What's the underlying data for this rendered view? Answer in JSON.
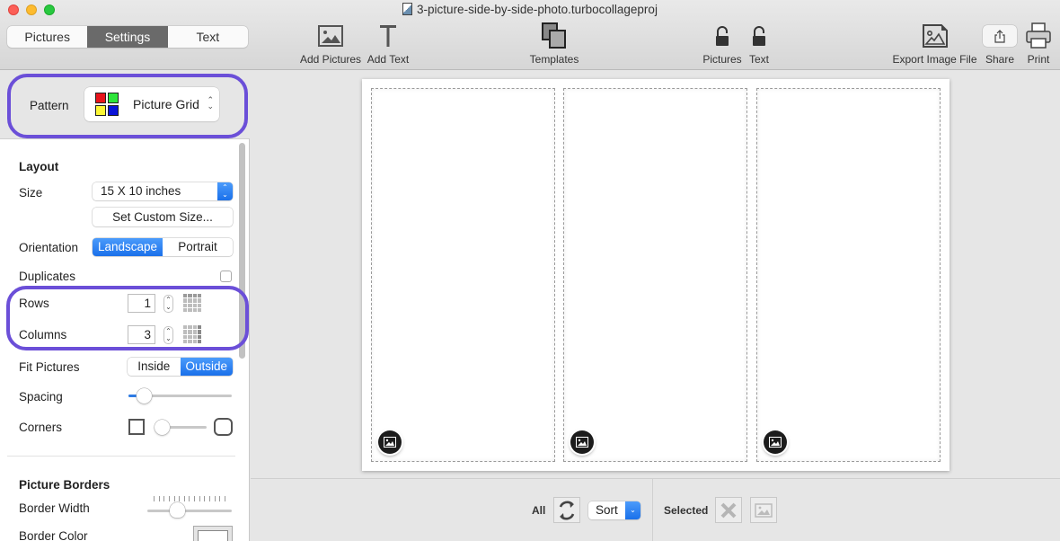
{
  "window": {
    "title": "3-picture-side-by-side-photo.turbocollageproj"
  },
  "tabs": [
    {
      "label": "Pictures",
      "active": false
    },
    {
      "label": "Settings",
      "active": true
    },
    {
      "label": "Text",
      "active": false
    }
  ],
  "toolbar": {
    "add_pictures": "Add Pictures",
    "add_text": "Add Text",
    "templates": "Templates",
    "lock_pictures": "Pictures",
    "lock_text": "Text",
    "export": "Export Image File",
    "share": "Share",
    "print": "Print"
  },
  "pattern": {
    "label": "Pattern",
    "value": "Picture Grid",
    "swatch_colors": [
      "#e8141b",
      "#2ee53a",
      "#fbf635",
      "#0a13d8"
    ]
  },
  "layout": {
    "section_title": "Layout",
    "size_label": "Size",
    "size_value": "15 X 10 inches",
    "custom_size_button": "Set Custom Size...",
    "orientation_label": "Orientation",
    "orientation_options": [
      "Landscape",
      "Portrait"
    ],
    "orientation_selected": "Landscape",
    "duplicates_label": "Duplicates",
    "duplicates_checked": false,
    "rows_label": "Rows",
    "rows_value": "1",
    "columns_label": "Columns",
    "columns_value": "3",
    "fit_label": "Fit Pictures",
    "fit_options": [
      "Inside",
      "Outside"
    ],
    "fit_selected": "Outside",
    "spacing_label": "Spacing",
    "spacing_level": 0.15,
    "corners_label": "Corners",
    "corners_level": 0.0
  },
  "picture_borders": {
    "section_title": "Picture Borders",
    "border_width_label": "Border Width",
    "border_width_level": 0.35,
    "border_color_label": "Border Color",
    "border_color": "#ffffff"
  },
  "canvas": {
    "cells": [
      {
        "name": "picture-cell-1"
      },
      {
        "name": "picture-cell-2"
      },
      {
        "name": "picture-cell-3"
      }
    ]
  },
  "bottom_bar": {
    "all_label": "All",
    "sort_value": "Sort",
    "selected_label": "Selected"
  },
  "colors": {
    "highlight": "#6b4fd8",
    "accent": "#1a70ea"
  }
}
